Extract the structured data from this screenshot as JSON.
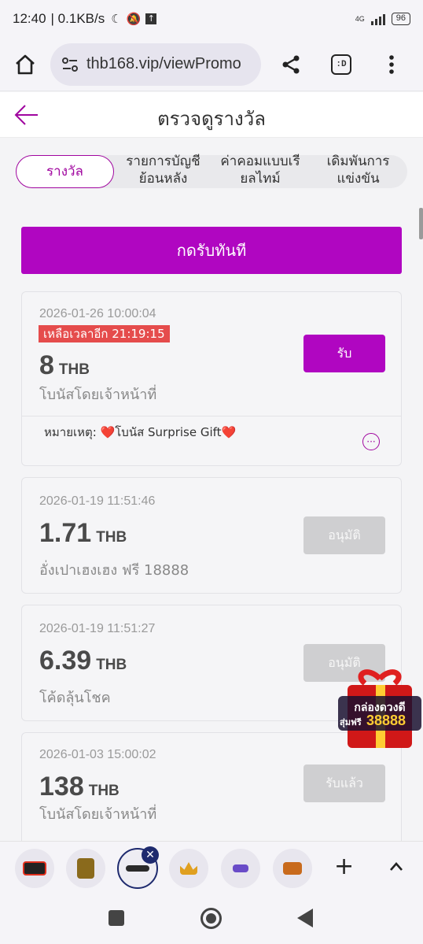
{
  "status_bar": {
    "time": "12:40",
    "speed": "| 0.1KB/s",
    "network": "4G",
    "battery": "96"
  },
  "browser": {
    "url": "thb168.vip/viewPromo",
    "tab_count": ":D"
  },
  "header": {
    "title": "ตรวจดูรางวัล"
  },
  "tabs": [
    {
      "label": "รางวัล",
      "active": true
    },
    {
      "label_line1": "รายการบัญชี",
      "label_line2": "ย้อนหลัง"
    },
    {
      "label_line1": "ค่าคอมแบบเรี",
      "label_line2": "ยลไทม์"
    },
    {
      "label_line1": "เดิมพันการ",
      "label_line2": "แข่งขัน"
    }
  ],
  "claim_all_label": "กดรับทันที",
  "rewards": [
    {
      "date": "2026-01-26 10:00:04",
      "countdown": "เหลือเวลาอีก 21:19:15",
      "amount": "8",
      "currency": "THB",
      "description": "โบนัสโดยเจ้าหน้าที่",
      "action_label": "รับ",
      "action_state": "active",
      "note_label": "หมายเหตุ:",
      "note_text": "❤️โบนัส Surprise Gift❤️"
    },
    {
      "date": "2026-01-19 11:51:46",
      "amount": "1.71",
      "currency": "THB",
      "description": "อั่งเปาเฮงเฮง ฟรี 18888",
      "action_label": "อนุมัติ",
      "action_state": "disabled"
    },
    {
      "date": "2026-01-19 11:51:27",
      "amount": "6.39",
      "currency": "THB",
      "description": "โค้ดลุ้นโชค",
      "action_label": "อนุมัติ",
      "action_state": "disabled"
    },
    {
      "date": "2026-01-03 15:00:02",
      "amount": "138",
      "currency": "THB",
      "description": "โบนัสโดยเจ้าหน้าที่",
      "action_label": "รับแล้ว",
      "action_state": "disabled"
    }
  ],
  "promo": {
    "line1": "กล่องดวงดี",
    "line2": "สุ่มฟรี",
    "number": "38888"
  },
  "colors": {
    "accent": "#b006c1",
    "tab_accent": "#a0069f",
    "countdown_bg": "#e54c4c",
    "disabled_button": "#cfcfd1"
  }
}
